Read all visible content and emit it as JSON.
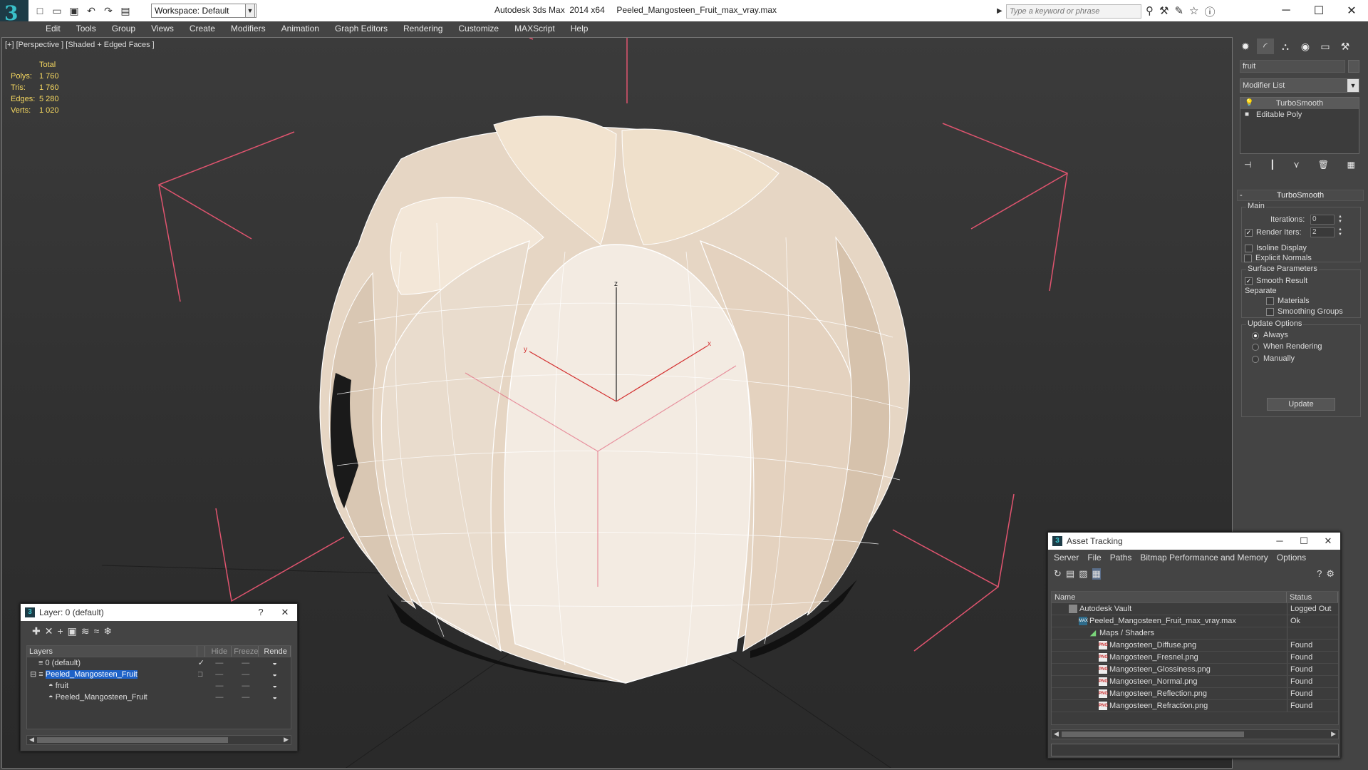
{
  "titlebar": {
    "workspace_label": "Workspace: Default",
    "app_title": "Autodesk 3ds Max  2014 x64     Peeled_Mangosteen_Fruit_max_vray.max",
    "search_placeholder": "Type a keyword or phrase"
  },
  "menu": [
    "Edit",
    "Tools",
    "Group",
    "Views",
    "Create",
    "Modifiers",
    "Animation",
    "Graph Editors",
    "Rendering",
    "Customize",
    "MAXScript",
    "Help"
  ],
  "viewport": {
    "label": "[+] [Perspective ] [Shaded + Edged Faces ]",
    "stats": {
      "header": "Total",
      "rows": [
        {
          "k": "Polys:",
          "v": "1 760"
        },
        {
          "k": "Tris:",
          "v": "1 760"
        },
        {
          "k": "Edges:",
          "v": "5 280"
        },
        {
          "k": "Verts:",
          "v": "1 020"
        }
      ]
    },
    "axis_labels": {
      "z": "z",
      "x": "x",
      "y": "y"
    },
    "colors": {
      "fruit": "#efe3d6",
      "wire": "#ffffff",
      "bbox": "#e0546f",
      "axis": "#d32f2f"
    }
  },
  "cmdpanel": {
    "object_name": "fruit",
    "modifier_list": "Modifier List",
    "stack": [
      "TurboSmooth",
      "Editable Poly"
    ],
    "rollout_title": "TurboSmooth",
    "main_group": "Main",
    "iterations_label": "Iterations:",
    "iterations_value": "0",
    "render_iters_label": "Render Iters:",
    "render_iters_value": "2",
    "isoline_label": "Isoline Display",
    "explicit_normals_label": "Explicit Normals",
    "surface_group": "Surface Parameters",
    "smooth_result_label": "Smooth Result",
    "separate_label": "Separate",
    "materials_label": "Materials",
    "smoothing_groups_label": "Smoothing Groups",
    "update_group": "Update Options",
    "always_label": "Always",
    "when_rendering_label": "When Rendering",
    "manually_label": "Manually",
    "update_button": "Update"
  },
  "layer_window": {
    "title": "Layer: 0 (default)",
    "help": "?",
    "columns": [
      "Layers",
      "Hide",
      "Freeze",
      "Rende"
    ],
    "rows": [
      {
        "name": "0 (default)",
        "indent": 0,
        "selected": false,
        "checked": true
      },
      {
        "name": "Peeled_Mangosteen_Fruit",
        "indent": 0,
        "selected": true,
        "checked": false
      },
      {
        "name": "fruit",
        "indent": 1,
        "selected": false,
        "checked": false
      },
      {
        "name": "Peeled_Mangosteen_Fruit",
        "indent": 1,
        "selected": false,
        "checked": false
      }
    ]
  },
  "asset_window": {
    "title": "Asset Tracking",
    "menu": [
      "Server",
      "File",
      "Paths",
      "Bitmap Performance and Memory",
      "Options"
    ],
    "columns": [
      "Name",
      "Status"
    ],
    "rows": [
      {
        "name": "Autodesk Vault",
        "status": "Logged Out",
        "indent": 1,
        "icon": "vault"
      },
      {
        "name": "Peeled_Mangosteen_Fruit_max_vray.max",
        "status": "Ok",
        "indent": 2,
        "icon": "max"
      },
      {
        "name": "Maps / Shaders",
        "status": "",
        "indent": 3,
        "icon": "folder"
      },
      {
        "name": "Mangosteen_Diffuse.png",
        "status": "Found",
        "indent": 4,
        "icon": "png"
      },
      {
        "name": "Mangosteen_Fresnel.png",
        "status": "Found",
        "indent": 4,
        "icon": "png"
      },
      {
        "name": "Mangosteen_Glossiness.png",
        "status": "Found",
        "indent": 4,
        "icon": "png"
      },
      {
        "name": "Mangosteen_Normal.png",
        "status": "Found",
        "indent": 4,
        "icon": "png"
      },
      {
        "name": "Mangosteen_Reflection.png",
        "status": "Found",
        "indent": 4,
        "icon": "png"
      },
      {
        "name": "Mangosteen_Refraction.png",
        "status": "Found",
        "indent": 4,
        "icon": "png"
      }
    ]
  }
}
